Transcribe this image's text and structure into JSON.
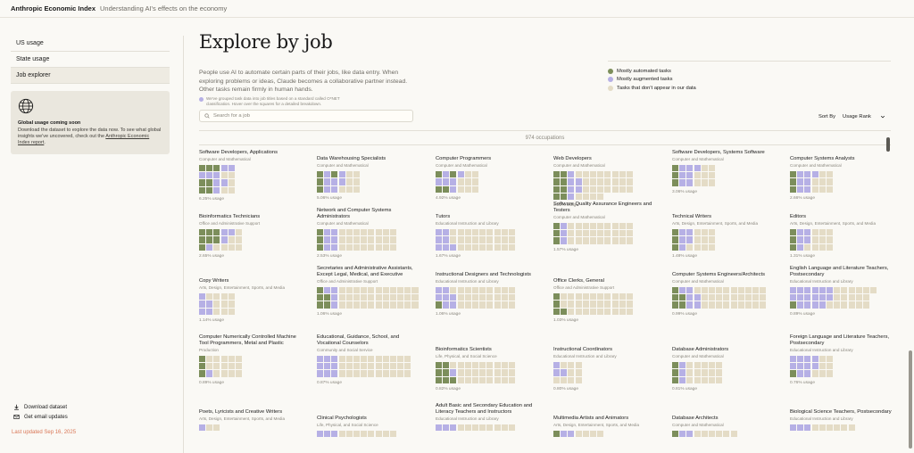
{
  "header": {
    "brand": "Anthropic Economic Index",
    "tagline": "Understanding AI's effects on the economy"
  },
  "sidebar": {
    "items": [
      {
        "label": "US usage",
        "active": false
      },
      {
        "label": "State usage",
        "active": false
      },
      {
        "label": "Job explorer",
        "active": true
      }
    ],
    "global_card": {
      "icon": "globe-icon",
      "title": "Global usage coming soon",
      "text": "Download the dataset to explore the data now. To see what global insights we've uncovered, check out the",
      "link": "Anthropic Economic Index report",
      "text_end": "."
    },
    "links": [
      {
        "icon": "download-icon",
        "label": "Download dataset"
      },
      {
        "icon": "mail-icon",
        "label": "Get email updates"
      }
    ],
    "updated": "Last updated Sep 16, 2025"
  },
  "main": {
    "title": "Explore by job",
    "intro": "People use AI to automate certain parts of their jobs, like data entry. When exploring problems or ideas, Claude becomes a collaborative partner instead. Other tasks remain firmly in human hands.",
    "note": "We've grouped task data into job titles based on a standard called O*NET classification. Hover over the squares for a detailed breakdown.",
    "legend": [
      {
        "label": "Mostly automated tasks",
        "color": "#7c8e5b"
      },
      {
        "label": "Mostly augmented tasks",
        "color": "#b6b0e5"
      },
      {
        "label": "Tasks that don't appear in our data",
        "color": "#e4dcc6"
      }
    ],
    "search_placeholder": "Search for a job",
    "sort_label": "Sort By",
    "sort_value": "Usage Rank",
    "count_label": "974 occupations"
  },
  "colors": {
    "auto": "#7c8e5b",
    "aug": "#b6b0e5",
    "none": "#e4dcc6",
    "accent": "#d97757"
  },
  "cards": [
    {
      "title": "Software Developers, Applications",
      "category": "Computer and Mathematical",
      "usage": "6.25% usage",
      "cells": "AAAGG GGGNN AAGGN AAGNN"
    },
    {
      "title": "Data Warehousing Specialists",
      "category": "Computer and Mathematical",
      "usage": "5.06% usage",
      "cells": "AGAGNN AGGGNN AGGNNN"
    },
    {
      "title": "Computer Programmers",
      "category": "Computer and Mathematical",
      "usage": "4.92% usage",
      "cells": "AGAGNN GGGNNN AAGNNN"
    },
    {
      "title": "Web Developers",
      "category": "Computer and Mathematical",
      "usage": "3.22% usage",
      "cells": "AAGNNNNNNNN AAGGNNNNNNN AAGGNNNNNNN AAGNNNN"
    },
    {
      "title": "Software Developers, Systems Software",
      "category": "Computer and Mathematical",
      "usage": "3.06% usage",
      "cells": "AGGGNN AGGNNN AGGNNN"
    },
    {
      "title": "Computer Systems Analysts",
      "category": "Computer and Mathematical",
      "usage": "2.66% usage",
      "cells": "AGGGNN AGGNNN AGGNNN"
    },
    {
      "title": "Bioinformatics Technicians",
      "category": "Office and Administrative Support",
      "usage": "2.65% usage",
      "cells": "AAAGGN AAAGNN AGNNNN"
    },
    {
      "title": "Network and Computer Systems Administrators",
      "category": "Computer and Mathematical",
      "usage": "2.53% usage",
      "cells": "AGGNNNNNNNN AGGNNNNNNNN AGGNNNNNNNN"
    },
    {
      "title": "Tutors",
      "category": "Educational Instruction and Library",
      "usage": "1.67% usage",
      "cells": "GGNNNNNNNNN GGNNNNNNNNN GGGNNNNNNNN"
    },
    {
      "title": "Software Quality Assurance Engineers and Testers",
      "category": "Computer and Mathematical",
      "usage": "1.57% usage",
      "cells": "AGNNNNNNNNN AGNNNNNNNNN AGNNNNNNNNN"
    },
    {
      "title": "Technical Writers",
      "category": "Arts, Design, Entertainment, Sports, and Media",
      "usage": "1.48% usage",
      "cells": "AGGNNN AGGNNN AGNNNN"
    },
    {
      "title": "Editors",
      "category": "Arts, Design, Entertainment, Sports, and Media",
      "usage": "1.31% usage",
      "cells": "AGGNNN AGGNNN AGNNNN"
    },
    {
      "title": "Copy Writers",
      "category": "Arts, Design, Entertainment, Sports, and Media",
      "usage": "1.14% usage",
      "cells": "GNNNN GGNNN GGNNN"
    },
    {
      "title": "Secretaries and Administrative Assistants, Except Legal, Medical, and Executive",
      "category": "Office and Administrative Support",
      "usage": "1.06% usage",
      "cells": "AGGNNNNNNNNNNN AAGNNNNNNNNNNN AAGNNNNNNNNNNN"
    },
    {
      "title": "Instructional Designers and Technologists",
      "category": "Educational Instruction and Library",
      "usage": "1.06% usage",
      "cells": "GGNNNNNNNNN GGGNNNNNNNN AGGNNNNNNNN"
    },
    {
      "title": "Office Clerks, General",
      "category": "Office and Administrative Support",
      "usage": "1.03% usage",
      "cells": "ANNNNNNNNNN ANNNNNNNNNN AANNNNNNNNN"
    },
    {
      "title": "Computer Systems Engineers/Architects",
      "category": "Computer and Mathematical",
      "usage": "0.99% usage",
      "cells": "AGGNNNNNNNNNN AAGGNNNNNNNNN AAGGNNNNNNNNN"
    },
    {
      "title": "English Language and Literature Teachers, Postsecondary",
      "category": "Educational Instruction and Library",
      "usage": "0.89% usage",
      "cells": "GGGGGGNNNNNN GGGGGGNNNNN AGGGGNNNNNN"
    },
    {
      "title": "Computer Numerically Controlled Machine Tool Programmers, Metal and Plastic",
      "category": "Production",
      "usage": "0.89% usage",
      "cells": "ANNNNN ANNNNN AGNNNN"
    },
    {
      "title": "Educational, Guidance, School, and Vocational Counselors",
      "category": "Community and Social Service",
      "usage": "0.87% usage",
      "cells": "GGGNNNNNNNNNN GGGNNNNNNNNNN GGGNNNNNNNNNN"
    },
    {
      "title": "Bioinformatics Scientists",
      "category": "Life, Physical, and Social Science",
      "usage": "0.82% usage",
      "cells": "AANNNNNNNNN AAGNNNNNNNN AAANNNNNNNN"
    },
    {
      "title": "Instructional Coordinators",
      "category": "Educational Instruction and Library",
      "usage": "0.80% usage",
      "cells": "GNNN GGNN NNNN"
    },
    {
      "title": "Database Administrators",
      "category": "Computer and Mathematical",
      "usage": "0.81% usage",
      "cells": "AGNNNNN AGNNNNN AGNNNNN"
    },
    {
      "title": "Foreign Language and Literature Teachers, Postsecondary",
      "category": "Educational Instruction and Library",
      "usage": "0.76% usage",
      "cells": "GGGGNN GGGGNN AGGNNN"
    },
    {
      "title": "Poets, Lyricists and Creative Writers",
      "category": "Arts, Design, Entertainment, Sports, and Media",
      "usage": "",
      "cells": "GNN"
    },
    {
      "title": "Clinical Psychologists",
      "category": "Life, Physical, and Social Science",
      "usage": "",
      "cells": "GGGNNNNNNNN"
    },
    {
      "title": "Adult Basic and Secondary Education and Literacy Teachers and Instructors",
      "category": "Educational Instruction and Library",
      "usage": "",
      "cells": "GGGNNNNNNNN"
    },
    {
      "title": "Multimedia Artists and Animators",
      "category": "Arts, Design, Entertainment, Sports, and Media",
      "usage": "",
      "cells": "AGGNNNN"
    },
    {
      "title": "Database Architects",
      "category": "Computer and Mathematical",
      "usage": "",
      "cells": "AGGNNNNNN"
    },
    {
      "title": "Biological Science Teachers, Postsecondary",
      "category": "Educational Instruction and Library",
      "usage": "",
      "cells": "GGGNNNNNN"
    }
  ]
}
